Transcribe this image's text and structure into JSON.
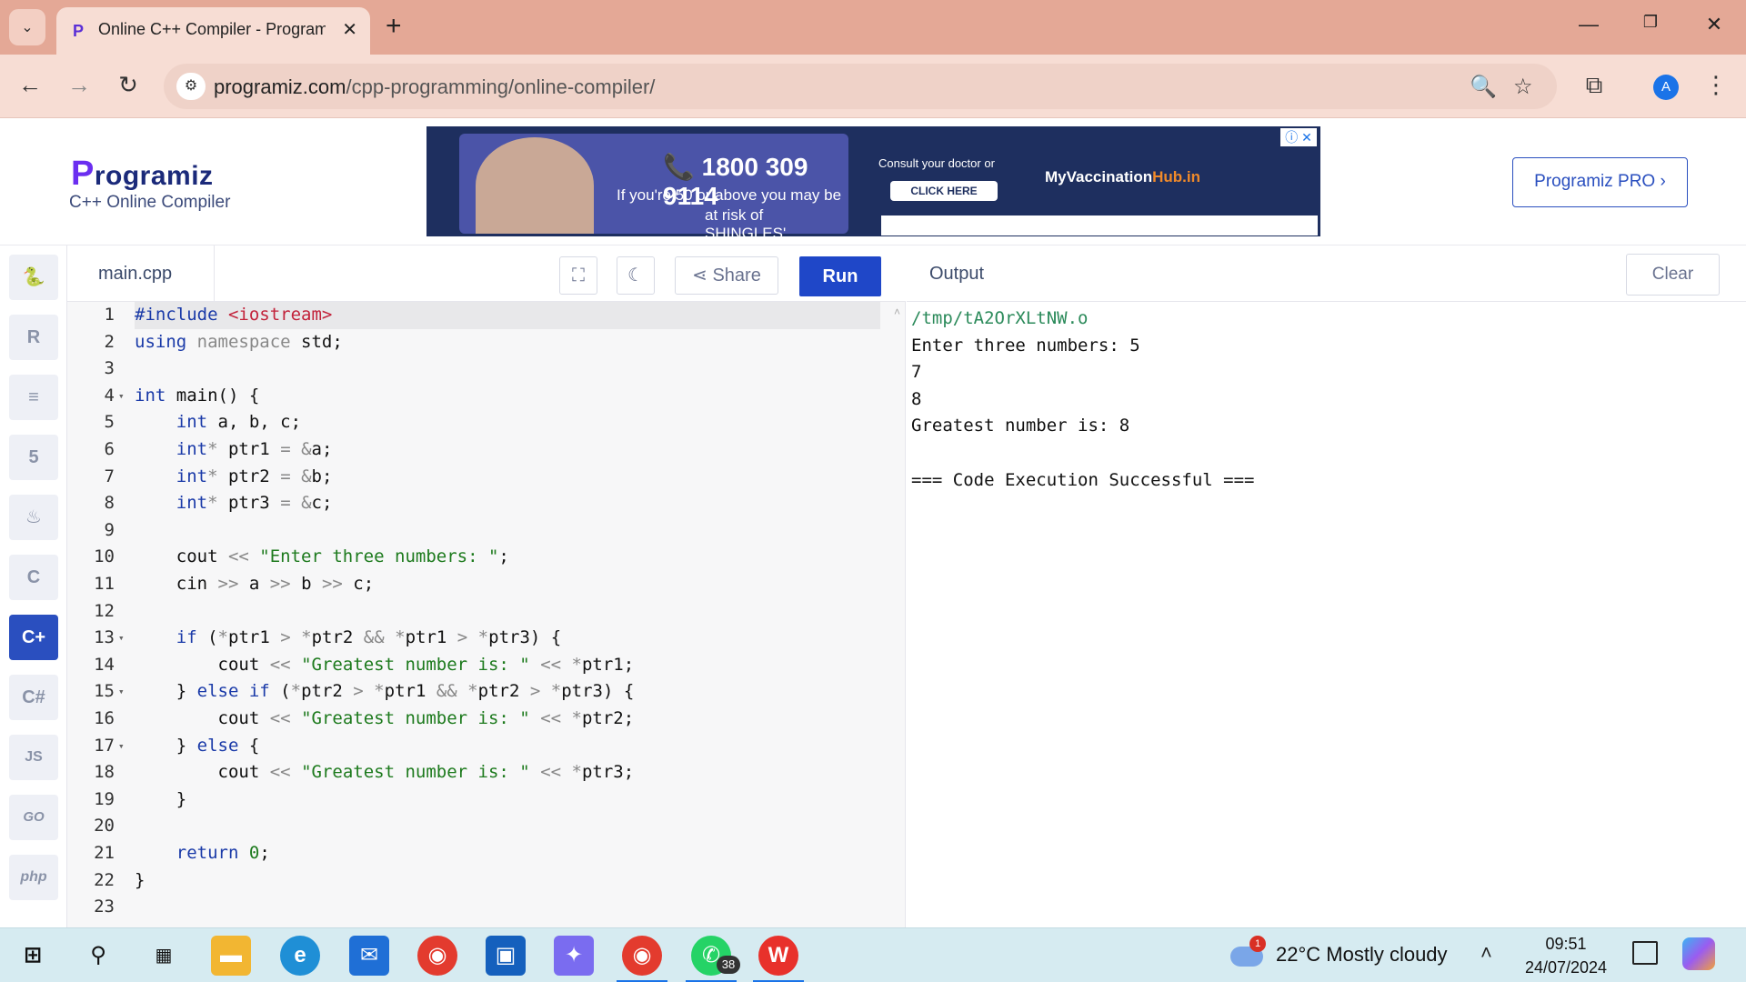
{
  "browser": {
    "tab_title": "Online C++ Compiler - Programiz",
    "tab_close_glyph": "✕",
    "new_tab_glyph": "+",
    "window_buttons": [
      "—",
      "❐",
      "✕"
    ],
    "url_host": "programiz.com",
    "url_path": "/cpp-programming/online-compiler/",
    "profile_initial": "A",
    "icons": [
      "chevron-down-icon",
      "back-icon",
      "forward-icon",
      "reload-icon",
      "site-settings-icon",
      "zoom-icon",
      "bookmark-star-icon",
      "extensions-icon",
      "more-vert-icon"
    ]
  },
  "site": {
    "logo": "rogramiz",
    "logo_first": "P",
    "subtitle": "C++ Online Compiler",
    "pro_button": "Programiz PRO ›"
  },
  "ad": {
    "phone": "📞 1800 309 9114",
    "line1": "If you're 50 or above you may be",
    "line2": "at risk of SHINGLES'",
    "consult": "Consult your doctor or",
    "cta": "CLICK HERE",
    "brand_a": "MyVaccination",
    "brand_b": "Hub.in",
    "close": "ⓘ ✕"
  },
  "rail": {
    "items": [
      {
        "name": "python",
        "glyph": "🐍"
      },
      {
        "name": "r",
        "glyph": "R"
      },
      {
        "name": "sql",
        "glyph": "≡"
      },
      {
        "name": "html",
        "glyph": "5"
      },
      {
        "name": "java",
        "glyph": "♨"
      },
      {
        "name": "c",
        "glyph": "C"
      },
      {
        "name": "cpp",
        "glyph": "C+"
      },
      {
        "name": "csharp",
        "glyph": "C#"
      },
      {
        "name": "js",
        "glyph": "JS"
      },
      {
        "name": "go",
        "glyph": "GO"
      },
      {
        "name": "php",
        "glyph": "php"
      }
    ],
    "active_index": 6
  },
  "editor": {
    "filename": "main.cpp",
    "share_label": "Share",
    "run_label": "Run",
    "lines": [
      "1",
      "2",
      "3",
      "4",
      "5",
      "6",
      "7",
      "8",
      "9",
      "10",
      "11",
      "12",
      "13",
      "14",
      "15",
      "16",
      "17",
      "18",
      "19",
      "20",
      "21",
      "22",
      "23"
    ],
    "fold_lines": [
      4,
      13,
      15,
      17
    ]
  },
  "output": {
    "title": "Output",
    "clear_label": "Clear",
    "lines": [
      "/tmp/tA2OrXLtNW.o",
      "Enter three numbers: 5",
      "7",
      "8",
      "Greatest number is: 8",
      "",
      "=== Code Execution Successful ==="
    ]
  },
  "taskbar": {
    "badge_count": "38",
    "weather_alert": "1",
    "weather": "22°C  Mostly cloudy",
    "time": "09:51",
    "date": "24/07/2024"
  },
  "colors": {
    "run_button": "#1f47c8",
    "active_rail": "#2a4fbf",
    "tabstrip": "#e4a896"
  }
}
